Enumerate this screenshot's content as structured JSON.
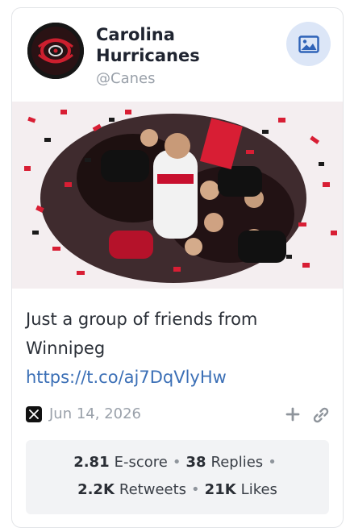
{
  "account": {
    "name": "Carolina Hurricanes",
    "handle": "@Canes"
  },
  "post": {
    "text": "Just a group of friends from Winnipeg",
    "link": "https://t.co/aj7DqVlyHw",
    "date": "Jun 14, 2026"
  },
  "stats": {
    "escore_value": "2.81",
    "escore_label": "E-score",
    "replies_value": "38",
    "replies_label": "Replies",
    "retweets_value": "2.2K",
    "retweets_label": "Retweets",
    "likes_value": "21K",
    "likes_label": "Likes",
    "separator": "•"
  },
  "icons": {
    "media_button": "image-icon",
    "platform": "x-logo-icon",
    "add": "plus-icon",
    "copy_link": "link-icon"
  },
  "colors": {
    "link": "#3b6fb6",
    "media_button_bg": "#dce6f7",
    "muted_text": "#9aa1aa",
    "stats_bg": "#f2f3f5"
  }
}
